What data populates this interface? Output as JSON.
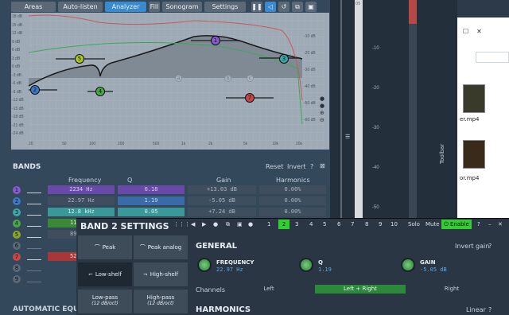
{
  "topbar": {
    "tabs": [
      {
        "label": "Areas"
      },
      {
        "label": "Auto-listen"
      },
      {
        "label": "Analyzer"
      },
      {
        "label": "Fill"
      },
      {
        "label": "Sonogram"
      },
      {
        "label": "Settings"
      }
    ],
    "icons": [
      "pause-icon",
      "speaker-icon",
      "reset-icon",
      "copy-icon",
      "paste-icon"
    ]
  },
  "graph": {
    "db_left": [
      "18 dB",
      "15 dB",
      "12 dB",
      "9 dB",
      "6 dB",
      "3 dB",
      "0 dB",
      "-3 dB",
      "-6 dB",
      "-9 dB",
      "-12 dB",
      "-15 dB",
      "-18 dB",
      "-21 dB",
      "-24 dB"
    ],
    "db_right": [
      "-10 dB",
      "-20 dB",
      "-30 dB",
      "-40 dB",
      "-50 dB",
      "-60 dB"
    ],
    "freq_ticks": [
      "20",
      "50",
      "100",
      "200",
      "500",
      "1k",
      "2k",
      "5k",
      "10k",
      "20k"
    ],
    "nodes": [
      {
        "id": "1"
      },
      {
        "id": "2"
      },
      {
        "id": "3"
      },
      {
        "id": "4"
      },
      {
        "id": "5"
      },
      {
        "id": "6"
      },
      {
        "id": "7"
      }
    ],
    "ghost_nodes": [
      "a",
      "b",
      "c"
    ]
  },
  "bands": {
    "title": "BANDS",
    "reset": "Reset",
    "invert": "Invert",
    "col_frequency": "Frequency",
    "col_q": "Q",
    "col_gain": "Gain",
    "col_harmonics": "Harmonics",
    "rows": [
      {
        "num": "1",
        "color": "#8a5ad0",
        "freq": "2234 Hz",
        "q": "0.18",
        "gain": "+13.03 dB",
        "harm": "0.00%"
      },
      {
        "num": "2",
        "color": "#3a7ac8",
        "freq": "22.97 Hz",
        "q": "1.19",
        "gain": "-5.05 dB",
        "harm": "0.00%"
      },
      {
        "num": "3",
        "color": "#3aa8a8",
        "freq": "12.8 kHz",
        "q": "0.05",
        "gain": "+7.24 dB",
        "harm": "0.00%"
      },
      {
        "num": "4",
        "color": "#4aa848",
        "freq": "11",
        "q": "",
        "gain": "",
        "harm": ""
      },
      {
        "num": "5",
        "color": "#8aa828",
        "freq": "89",
        "q": "",
        "gain": "",
        "harm": ""
      },
      {
        "num": "6",
        "color": "#5a6a78",
        "freq": "",
        "q": "",
        "gain": "",
        "harm": ""
      },
      {
        "num": "7",
        "color": "#c84848",
        "freq": "52",
        "q": "",
        "gain": "",
        "harm": ""
      },
      {
        "num": "8",
        "color": "#5a6a78",
        "freq": "",
        "q": "",
        "gain": "",
        "harm": ""
      },
      {
        "num": "9",
        "color": "#5a6a78",
        "freq": "",
        "q": "",
        "gain": "",
        "harm": ""
      }
    ]
  },
  "auto_eq": {
    "title": "AUTOMATIC EQUAL"
  },
  "meter": {
    "labels": [
      "-10",
      "-20",
      "-30",
      "-40",
      "-50"
    ],
    "toolbar": "Toolbar",
    "top_label": "05"
  },
  "explorer": {
    "files": [
      {
        "label": "er.mp4"
      },
      {
        "label": "or.mp4"
      }
    ]
  },
  "band_settings": {
    "title": "BAND 2 SETTINGS",
    "band_numbers": [
      "1",
      "2",
      "3",
      "4",
      "5",
      "6",
      "7",
      "8",
      "9",
      "10"
    ],
    "active_band": "2",
    "solo": "Solo",
    "mute": "Mute",
    "enable": "Enable",
    "help": "?",
    "filters": [
      {
        "label": "Peak",
        "sub": ""
      },
      {
        "label": "Peak analog",
        "sub": ""
      },
      {
        "label": "Low-shelf",
        "sub": ""
      },
      {
        "label": "High-shelf",
        "sub": ""
      },
      {
        "label": "Low-pass",
        "sub": "(12 dB/oct)"
      },
      {
        "label": "High-pass",
        "sub": "(12 dB/oct)"
      }
    ],
    "active_filter": "Low-shelf",
    "general_title": "GENERAL",
    "invert_gain": "Invert gain",
    "knobs": [
      {
        "label": "FREQUENCY",
        "value": "22.97 Hz",
        "level": 0.05
      },
      {
        "label": "Q",
        "value": "1.19",
        "level": 0.55
      },
      {
        "label": "GAIN",
        "value": "-5.05 dB",
        "level": 0.4
      }
    ],
    "channels_label": "Channels",
    "channels": [
      {
        "label": "Left"
      },
      {
        "label": "Left + Right"
      },
      {
        "label": "Right"
      }
    ],
    "active_channel": "Left + Right",
    "harmonics_title": "HARMONICS",
    "linear": "Linear"
  },
  "colors": {
    "accent": "#3a8ad0",
    "green": "#33cc33",
    "purple": "#8a5ad0"
  }
}
